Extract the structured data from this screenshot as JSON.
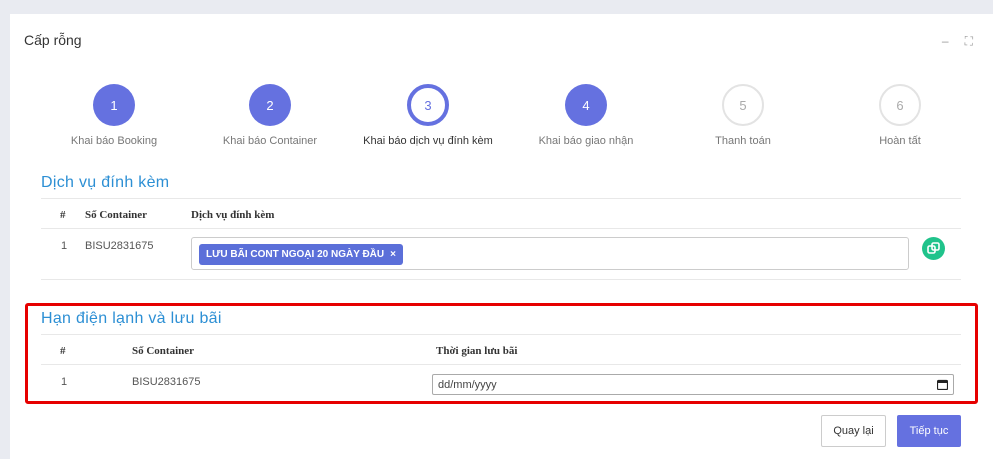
{
  "window": {
    "title": "Cấp rỗng",
    "minimize_glyph": "–",
    "maximize_glyph": "⛶"
  },
  "steps": [
    {
      "number": "1",
      "label": "Khai báo Booking",
      "state": "done"
    },
    {
      "number": "2",
      "label": "Khai báo Container",
      "state": "done"
    },
    {
      "number": "3",
      "label": "Khai báo dịch vụ đính kèm",
      "state": "active"
    },
    {
      "number": "4",
      "label": "Khai báo giao nhận",
      "state": "done"
    },
    {
      "number": "5",
      "label": "Thanh toán",
      "state": "todo"
    },
    {
      "number": "6",
      "label": "Hoàn tất",
      "state": "todo"
    }
  ],
  "services": {
    "title": "Dịch vụ đính kèm",
    "headers": {
      "index": "#",
      "container": "Số Container",
      "service": "Dịch vụ đính kèm"
    },
    "rows": [
      {
        "index": "1",
        "container": "BISU2831675",
        "tag": "LƯU BÃI CONT NGOẠI 20 NGÀY ĐẦU",
        "tag_remove": "×"
      }
    ]
  },
  "storage": {
    "title": "Hạn điện lạnh và lưu bãi",
    "headers": {
      "index": "#",
      "container": "Số Container",
      "time": "Thời gian lưu bãi"
    },
    "rows": [
      {
        "index": "1",
        "container": "BISU2831675",
        "date_placeholder": "dd/mm/yyyy"
      }
    ]
  },
  "footer": {
    "back_label": "Quay lại",
    "next_label": "Tiếp tục"
  },
  "colors": {
    "primary": "#6571e0",
    "section_title": "#2c8fd4",
    "copy_button": "#20c38b",
    "highlight_frame": "#e60000"
  },
  "icons": {
    "copy": "copy-icon",
    "calendar": "calendar-icon",
    "minimize": "minimize-icon",
    "maximize": "maximize-icon"
  }
}
